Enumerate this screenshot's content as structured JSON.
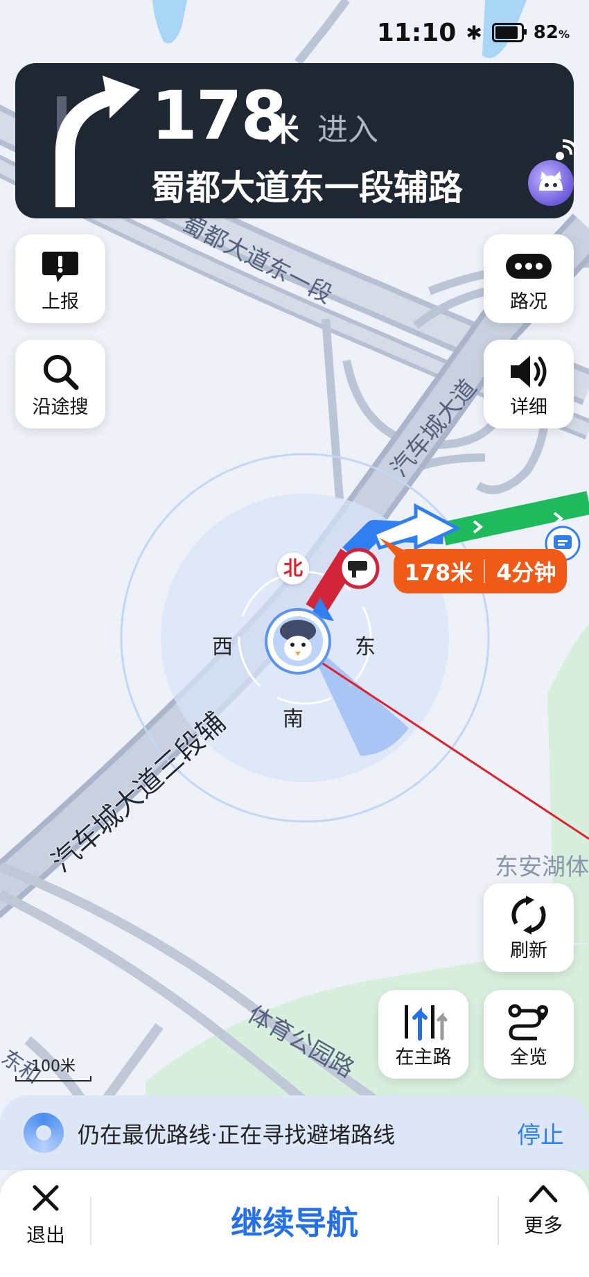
{
  "status_bar": {
    "time": "11:10",
    "battery": "82",
    "battery_unit": "%"
  },
  "guidance": {
    "distance": "178",
    "unit": "米",
    "action": "进入",
    "road": "蜀都大道东一段辅路"
  },
  "buttons": {
    "report": "上报",
    "search_along": "沿途搜",
    "traffic": "路况",
    "detail": "详细",
    "refresh": "刷新",
    "main_road": "在主路",
    "overview": "全览"
  },
  "route_info": {
    "distance": "178米",
    "time": "4分钟"
  },
  "compass": {
    "north": "北",
    "south": "南",
    "east": "东",
    "west": "西"
  },
  "map_labels": {
    "road_top": "蜀都大道东一段",
    "road_right": "汽车城大道",
    "road_main": "汽车城大道三段辅",
    "road_bottom": "体育公园路",
    "poi": "东安湖体",
    "road_left_edge": "东和"
  },
  "scale": "100米",
  "status_strip": {
    "message": "仍在最优路线·正在寻找避堵路线",
    "stop": "停止"
  },
  "bottom_bar": {
    "exit": "退出",
    "continue": "继续导航",
    "more": "更多"
  },
  "colors": {
    "banner_bg": "#1f2733",
    "pill": "#f05a17",
    "accent_blue": "#2370e8",
    "route_green": "#1fba5c",
    "route_red": "#d3253a"
  }
}
